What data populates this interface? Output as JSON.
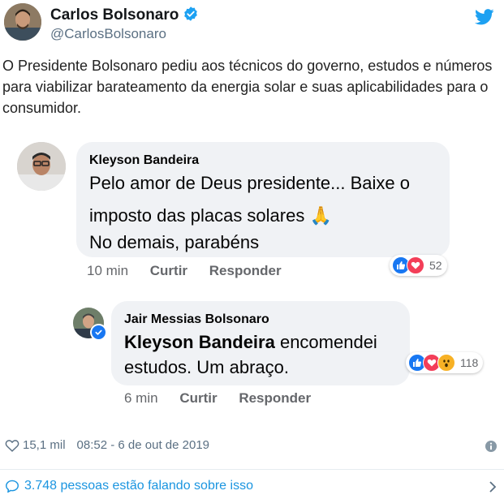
{
  "tweet": {
    "author_name": "Carlos Bolsonaro",
    "author_handle": "@CarlosBolsonaro",
    "text": "O Presidente Bolsonaro pediu aos técnicos do governo, estudos e números para viabilizar barateamento da energia solar e suas aplicabilidades para o consumidor.",
    "likes": "15,1 mil",
    "timestamp": "08:52 - 6 de out de 2019",
    "talking": "3.748 pessoas estão falando sobre isso"
  },
  "comments": [
    {
      "author": "Kleyson Bandeira",
      "lines": [
        "Pelo amor de Deus presidente... Baixe o",
        "imposto das placas solares 🙏",
        "No demais, parabéns"
      ],
      "time": "10 min",
      "like_label": "Curtir",
      "reply_label": "Responder",
      "reaction_count": "52",
      "reactions": [
        "like-icon",
        "love-icon"
      ]
    },
    {
      "author": "Jair Messias Bolsonaro",
      "mention": "Kleyson Bandeira",
      "line1_rest": " encomendei",
      "line2": "estudos. Um abraço.",
      "time": "6 min",
      "like_label": "Curtir",
      "reply_label": "Responder",
      "reaction_count": "118",
      "reactions": [
        "like-icon",
        "love-icon",
        "wow-icon"
      ]
    }
  ],
  "colors": {
    "twitter_blue": "#1da1f2",
    "link_blue": "#1b95e0",
    "fb_like": "#1877f2",
    "fb_love": "#f33e58",
    "fb_wow": "#f7b125"
  }
}
